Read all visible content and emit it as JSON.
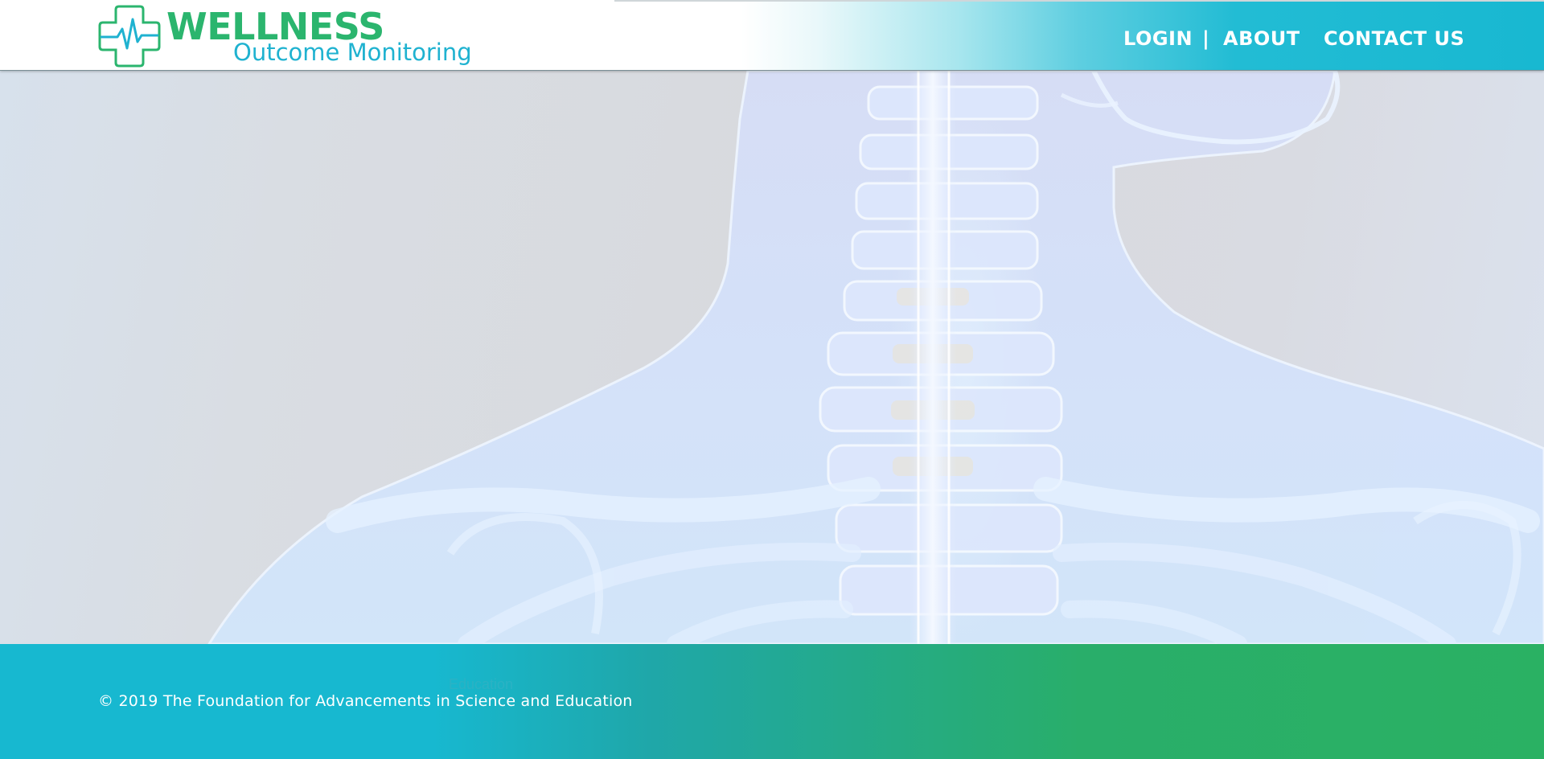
{
  "header": {
    "logo": {
      "title": "WELLNESS",
      "subtitle": "Outcome Monitoring",
      "icon": "medical-cross-heartbeat-icon"
    },
    "nav": {
      "login": "LOGIN",
      "separator": "|",
      "about": "ABOUT",
      "contact": "CONTACT US"
    }
  },
  "hero": {
    "image": "skeleton-xray-neck-shoulders"
  },
  "footer": {
    "ghost_text": "Education",
    "copyright": "© 2019 The Foundation for Advancements in Science and Education"
  },
  "colors": {
    "brand_green": "#2bb56e",
    "brand_teal": "#1fb2d0",
    "footer_start": "#17b8d0",
    "footer_end": "#2ab163"
  }
}
